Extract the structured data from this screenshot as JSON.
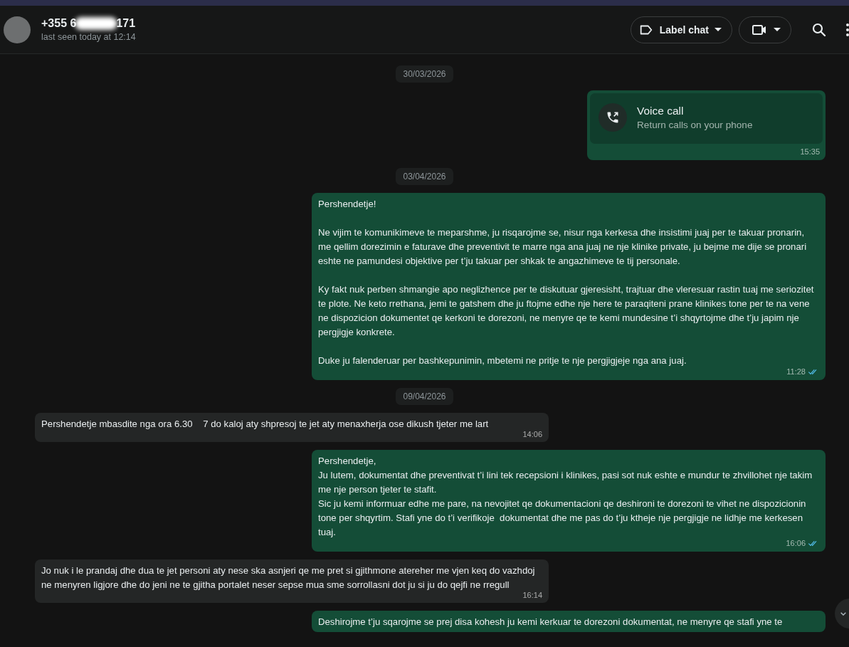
{
  "contact": {
    "name_start": "+355 6",
    "name_end": "171",
    "status": "last seen today at 12:14"
  },
  "header_actions": {
    "label_button": "Label chat"
  },
  "messages": [
    {
      "kind": "date",
      "text": "30/03/2026"
    },
    {
      "kind": "call",
      "outgoing": true,
      "title": "Voice call",
      "subtitle": "Return calls on your phone",
      "time": "15:35"
    },
    {
      "kind": "date",
      "text": "03/04/2026"
    },
    {
      "kind": "text",
      "outgoing": true,
      "text": "Pershendetje!\n\nNe vijim te komunikimeve te meparshme, ju risqarojme se, nisur nga kerkesa dhe insistimi juaj per te takuar pronarin, me qellim dorezimin e faturave dhe preventivit te marre nga ana juaj ne nje klinike private, ju bejme me dije se pronari eshte ne pamundesi objektive per t’ju takuar per shkak te angazhimeve te tij personale.\n\nKy fakt nuk perben shmangie apo neglizhence per te diskutuar gjeresisht, trajtuar dhe vleresuar rastin tuaj me seriozitet te plote. Ne keto rrethana, jemi te gatshem dhe ju ftojme edhe nje here te paraqiteni prane klinikes tone per te na vene ne dispozicion dokumentet qe kerkoni te dorezoni, ne menyre qe te kemi mundesine t’i shqyrtojme dhe t’ju japim nje pergjigje konkrete.\n\nDuke ju falenderuar per bashkepunimin, mbetemi ne pritje te nje pergjigjeje nga ana juaj.",
      "time": "11:28",
      "read": true
    },
    {
      "kind": "date",
      "text": "09/04/2026"
    },
    {
      "kind": "text",
      "outgoing": false,
      "text": "Pershendetje mbasdite nga ora 6.30    7 do kaloj aty shpresoj te jet aty menaxherja ose dikush tjeter me lart",
      "time": "14:06"
    },
    {
      "kind": "text",
      "outgoing": true,
      "text": "Pershendetje,\nJu lutem, dokumentat dhe preventivat t’i lini tek recepsioni i klinikes, pasi sot nuk eshte e mundur te zhvillohet nje takim me nje person tjeter te stafit.\nSic ju kemi informuar edhe me pare, na nevojitet qe dokumentacioni qe deshironi te dorezoni te vihet ne dispozicionin tone per shqyrtim. Stafi yne do t’i verifikoje  dokumentat dhe me pas do t’ju ktheje nje pergjigje ne lidhje me kerkesen tuaj.",
      "time": "16:06",
      "read": true
    },
    {
      "kind": "text",
      "outgoing": false,
      "text": "Jo nuk i le prandaj dhe dua te jet personi aty nese ska asnjeri qe me pret si gjithmone atereher me vjen keq do vazhdoj ne menyren ligjore dhe do jeni ne te gjitha portalet neser sepse mua sme sorrollasni dot ju si ju do qejfi ne rregull",
      "time": "16:14"
    },
    {
      "kind": "text",
      "outgoing": true,
      "text": "Deshirojme t’ju sqarojme se prej disa kohesh ju kemi kerkuar te dorezoni dokumentat, ne menyre qe stafi yne te"
    }
  ]
}
